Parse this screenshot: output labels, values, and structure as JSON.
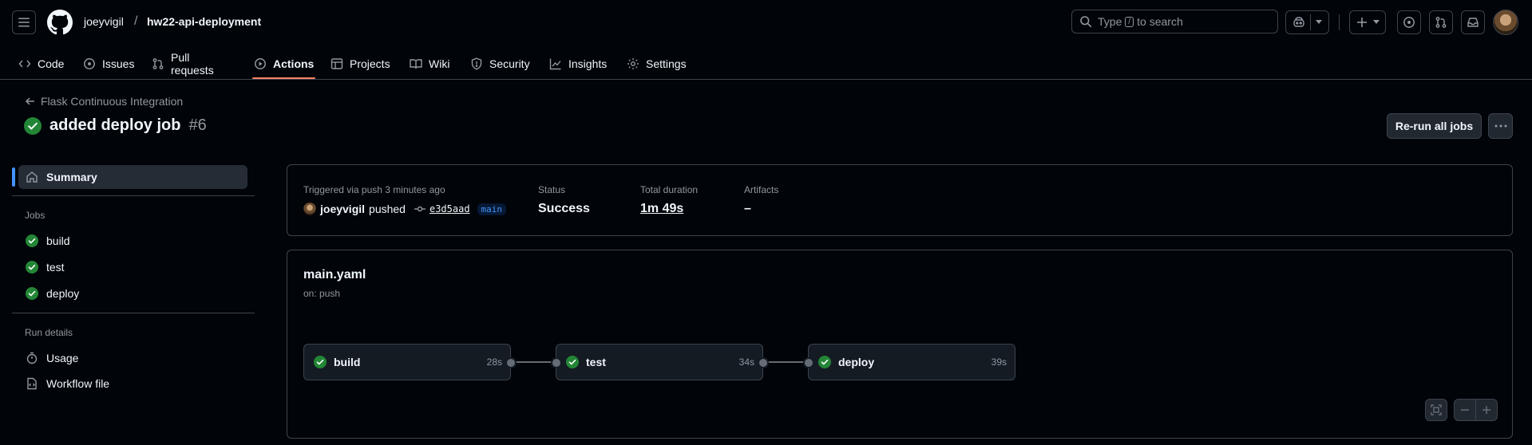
{
  "header": {
    "owner": "joeyvigil",
    "separator": "/",
    "repo": "hw22-api-deployment",
    "search_prefix": "Type",
    "search_key": "/",
    "search_suffix": "to search"
  },
  "tabs": [
    {
      "label": "Code",
      "icon": "code-icon"
    },
    {
      "label": "Issues",
      "icon": "issue-icon"
    },
    {
      "label": "Pull requests",
      "icon": "pull-request-icon"
    },
    {
      "label": "Actions",
      "icon": "play-icon",
      "active": true
    },
    {
      "label": "Projects",
      "icon": "table-icon"
    },
    {
      "label": "Wiki",
      "icon": "book-icon"
    },
    {
      "label": "Security",
      "icon": "shield-icon"
    },
    {
      "label": "Insights",
      "icon": "graph-icon"
    },
    {
      "label": "Settings",
      "icon": "gear-icon"
    }
  ],
  "run": {
    "workflow_back": "Flask Continuous Integration",
    "title": "added deploy job",
    "number": "#6",
    "rerun_label": "Re-run all jobs"
  },
  "sidebar": {
    "summary": "Summary",
    "jobs_heading": "Jobs",
    "jobs": [
      "build",
      "test",
      "deploy"
    ],
    "details_heading": "Run details",
    "usage": "Usage",
    "workflow_file": "Workflow file"
  },
  "summary": {
    "trigger": "Triggered via push 3 minutes ago",
    "actor": "joeyvigil",
    "action": "pushed",
    "commit": "e3d5aad",
    "branch": "main",
    "status_label": "Status",
    "status_value": "Success",
    "duration_label": "Total duration",
    "duration_value": "1m 49s",
    "artifacts_label": "Artifacts",
    "artifacts_value": "–"
  },
  "workflow": {
    "file": "main.yaml",
    "on": "on: push",
    "jobs": [
      {
        "name": "build",
        "duration": "28s"
      },
      {
        "name": "test",
        "duration": "34s"
      },
      {
        "name": "deploy",
        "duration": "39s"
      }
    ]
  },
  "colors": {
    "success": "#238636",
    "accent": "#4493f8",
    "tab_underline": "#f78166"
  }
}
